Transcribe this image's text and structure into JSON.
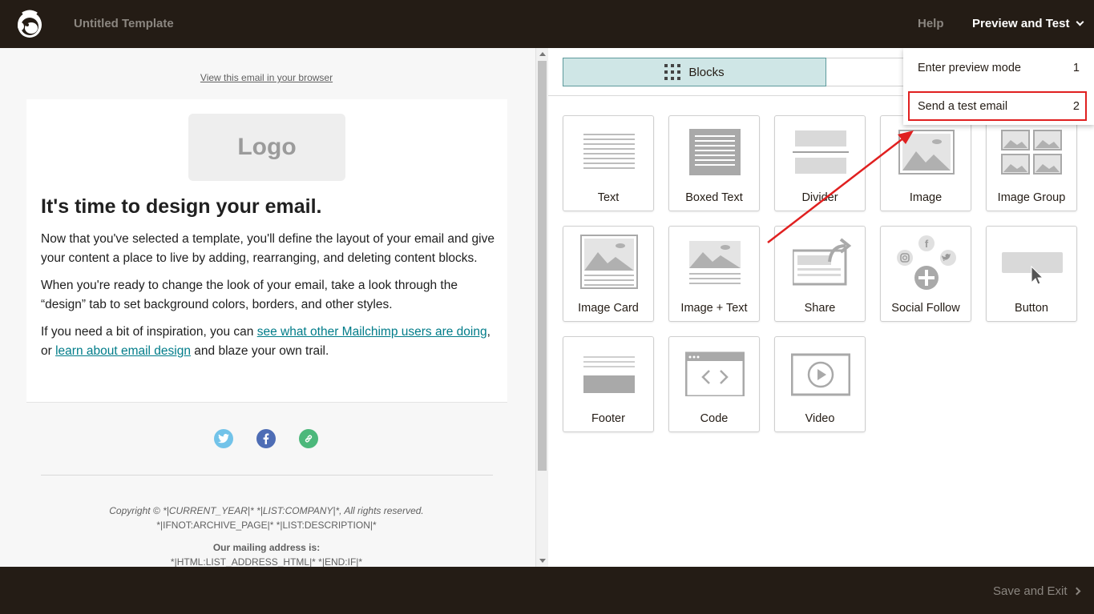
{
  "header": {
    "title": "Untitled Template",
    "help": "Help",
    "preview_button": "Preview and Test"
  },
  "dropdown": {
    "items": [
      {
        "label": "Enter preview mode",
        "shortcut": "1"
      },
      {
        "label": "Send a test email",
        "shortcut": "2"
      }
    ]
  },
  "email": {
    "view_in_browser": "View this email in your browser",
    "logo_placeholder": "Logo",
    "heading": "It's time to design your email.",
    "para1": "Now that you've selected a template, you'll define the layout of your email and give your content a place to live by adding, rearranging, and deleting content blocks.",
    "para2": "When you're ready to change the look of your email, take a look through the “design” tab to set background colors, borders, and other styles.",
    "para3_prefix": "If you need a bit of inspiration, you can ",
    "para3_link1": "see what other Mailchimp users are doing",
    "para3_mid": ", or ",
    "para3_link2": "learn about email design",
    "para3_suffix": " and blaze your own trail.",
    "footer_copyright": "Copyright © *|CURRENT_YEAR|* *|LIST:COMPANY|*, All rights reserved.",
    "footer_archive": "*|IFNOT:ARCHIVE_PAGE|* *|LIST:DESCRIPTION|*",
    "footer_mailing_heading": "Our mailing address is:",
    "footer_mailing_address": "*|HTML:LIST_ADDRESS_HTML|* *|END:IF|*"
  },
  "tabs": {
    "blocks": "Blocks"
  },
  "blocks": [
    {
      "label": "Text"
    },
    {
      "label": "Boxed Text"
    },
    {
      "label": "Divider"
    },
    {
      "label": "Image"
    },
    {
      "label": "Image Group"
    },
    {
      "label": "Image Card"
    },
    {
      "label": "Image + Text"
    },
    {
      "label": "Share"
    },
    {
      "label": "Social Follow"
    },
    {
      "label": "Button"
    },
    {
      "label": "Footer"
    },
    {
      "label": "Code"
    },
    {
      "label": "Video"
    }
  ],
  "footer": {
    "save_exit": "Save and Exit"
  },
  "colors": {
    "topbar": "#241c15",
    "accent_teal": "#007c89",
    "annotation_red": "#e02020",
    "twitter": "#72c3e9",
    "facebook": "#4e6db5",
    "link": "#4cb87b"
  }
}
